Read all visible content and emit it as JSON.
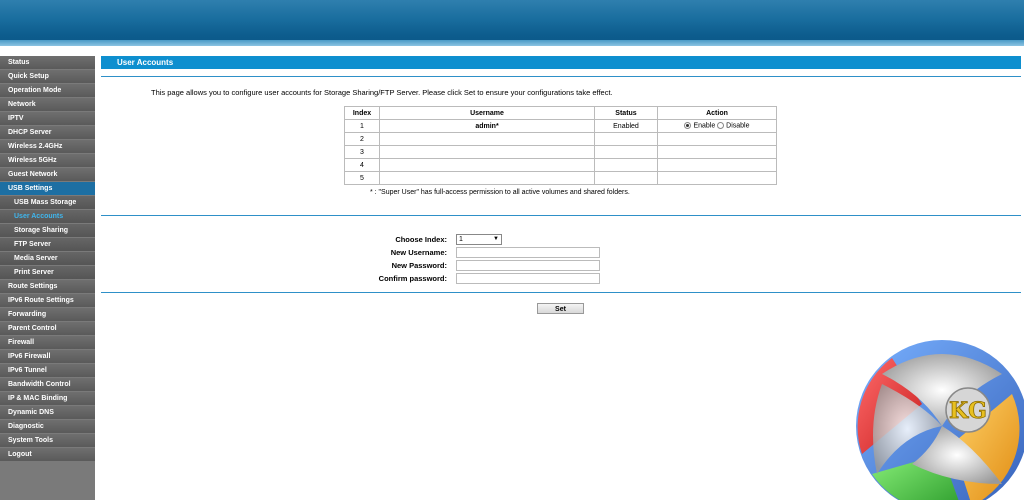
{
  "sidebar": {
    "items": [
      {
        "label": "Status",
        "kind": "top"
      },
      {
        "label": "Quick Setup",
        "kind": "top"
      },
      {
        "label": "Operation Mode",
        "kind": "top"
      },
      {
        "label": "Network",
        "kind": "top"
      },
      {
        "label": "IPTV",
        "kind": "top"
      },
      {
        "label": "DHCP Server",
        "kind": "top"
      },
      {
        "label": "Wireless 2.4GHz",
        "kind": "top"
      },
      {
        "label": "Wireless 5GHz",
        "kind": "top"
      },
      {
        "label": "Guest Network",
        "kind": "top"
      },
      {
        "label": "USB Settings",
        "kind": "active"
      },
      {
        "label": "USB Mass Storage",
        "kind": "sub"
      },
      {
        "label": "User Accounts",
        "kind": "sub-current"
      },
      {
        "label": "Storage Sharing",
        "kind": "sub"
      },
      {
        "label": "FTP Server",
        "kind": "sub"
      },
      {
        "label": "Media Server",
        "kind": "sub"
      },
      {
        "label": "Print Server",
        "kind": "sub"
      },
      {
        "label": "Route Settings",
        "kind": "top"
      },
      {
        "label": "IPv6 Route Settings",
        "kind": "top"
      },
      {
        "label": "Forwarding",
        "kind": "top"
      },
      {
        "label": "Parent Control",
        "kind": "top"
      },
      {
        "label": "Firewall",
        "kind": "top"
      },
      {
        "label": "IPv6 Firewall",
        "kind": "top"
      },
      {
        "label": "IPv6 Tunnel",
        "kind": "top"
      },
      {
        "label": "Bandwidth Control",
        "kind": "top"
      },
      {
        "label": "IP & MAC Binding",
        "kind": "top"
      },
      {
        "label": "Dynamic DNS",
        "kind": "top"
      },
      {
        "label": "Diagnostic",
        "kind": "top"
      },
      {
        "label": "System Tools",
        "kind": "top"
      },
      {
        "label": "Logout",
        "kind": "top"
      }
    ]
  },
  "main": {
    "title": "User Accounts",
    "description": "This page allows you to configure user accounts for Storage Sharing/FTP Server. Please click Set to ensure your configurations take effect.",
    "table": {
      "headers": {
        "index": "Index",
        "username": "Username",
        "status": "Status",
        "action": "Action"
      },
      "rows": [
        {
          "index": "1",
          "username": "admin*",
          "status": "Enabled",
          "enable_label": "Enable",
          "disable_label": "Disable",
          "selected": "enable"
        },
        {
          "index": "2",
          "username": "",
          "status": ""
        },
        {
          "index": "3",
          "username": "",
          "status": ""
        },
        {
          "index": "4",
          "username": "",
          "status": ""
        },
        {
          "index": "5",
          "username": "",
          "status": ""
        }
      ]
    },
    "note": "* : \"Super User\" has full-access permission to all active volumes and shared folders.",
    "form": {
      "choose_index_label": "Choose Index:",
      "choose_index_value": "1",
      "new_username_label": "New Username:",
      "new_username_value": "",
      "new_password_label": "New Password:",
      "new_password_value": "",
      "confirm_password_label": "Confirm password:",
      "confirm_password_value": ""
    },
    "set_label": "Set"
  },
  "logo": {
    "text": "KG"
  },
  "colors": {
    "header": "#0e8fcf",
    "accent": "#2e90c8",
    "active_nav": "#1d6fa3",
    "current_sub": "#3fb6ee"
  }
}
